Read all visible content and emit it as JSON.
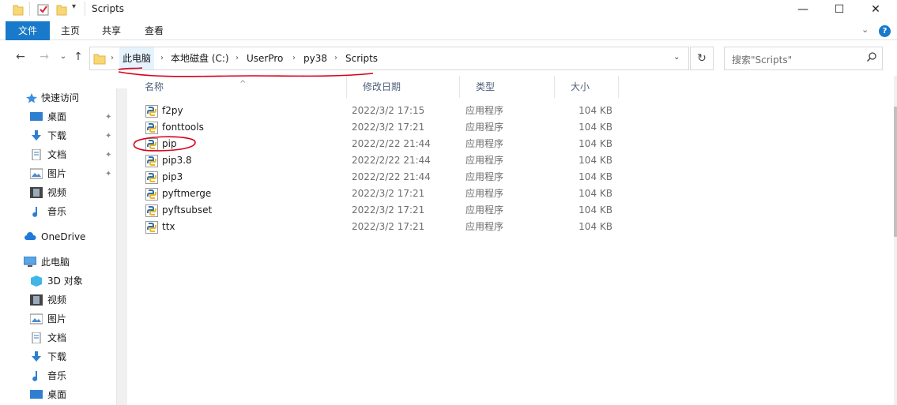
{
  "window": {
    "title": "Scripts",
    "minimize_label": "—",
    "maximize_label": "☐",
    "close_label": "✕"
  },
  "ribbon": {
    "tabs": [
      {
        "label": "文件",
        "active": true
      },
      {
        "label": "主页"
      },
      {
        "label": "共享"
      },
      {
        "label": "查看"
      }
    ],
    "collapse_label": "⌄",
    "help_label": "?"
  },
  "nav": {
    "back_label": "←",
    "forward_label": "→",
    "recent_label": "⌄",
    "up_label": "↑",
    "breadcrumbs": [
      "此电脑",
      "本地磁盘 (C:)",
      "UserPro",
      "py38",
      "Scripts"
    ],
    "refresh_label": "↻"
  },
  "search": {
    "placeholder": "搜索\"Scripts\""
  },
  "sidebar": {
    "items": [
      {
        "label": "快速访问",
        "icon": "star-icon"
      },
      {
        "label": "桌面",
        "icon": "desktop-icon",
        "pinned": true
      },
      {
        "label": "下载",
        "icon": "download-icon",
        "pinned": true
      },
      {
        "label": "文档",
        "icon": "document-icon",
        "pinned": true
      },
      {
        "label": "图片",
        "icon": "picture-icon",
        "pinned": true
      },
      {
        "label": "视频",
        "icon": "video-icon"
      },
      {
        "label": "音乐",
        "icon": "music-icon"
      },
      {
        "label": "OneDrive",
        "icon": "cloud-icon"
      },
      {
        "label": "此电脑",
        "icon": "computer-icon"
      },
      {
        "label": "3D 对象",
        "icon": "cube-icon"
      },
      {
        "label": "视频",
        "icon": "video-icon"
      },
      {
        "label": "图片",
        "icon": "picture-icon"
      },
      {
        "label": "文档",
        "icon": "document-icon"
      },
      {
        "label": "下载",
        "icon": "download-icon"
      },
      {
        "label": "音乐",
        "icon": "music-icon"
      },
      {
        "label": "桌面",
        "icon": "desktop-icon"
      }
    ],
    "pin_glyph": "📌"
  },
  "filelist": {
    "columns": {
      "name": "名称",
      "date": "修改日期",
      "type": "类型",
      "size": "大小"
    },
    "sort_glyph": "^",
    "rows": [
      {
        "name": "f2py",
        "date": "2022/3/2 17:15",
        "type": "应用程序",
        "size": "104 KB"
      },
      {
        "name": "fonttools",
        "date": "2022/3/2 17:21",
        "type": "应用程序",
        "size": "104 KB"
      },
      {
        "name": "pip",
        "date": "2022/2/22 21:44",
        "type": "应用程序",
        "size": "104 KB"
      },
      {
        "name": "pip3.8",
        "date": "2022/2/22 21:44",
        "type": "应用程序",
        "size": "104 KB"
      },
      {
        "name": "pip3",
        "date": "2022/2/22 21:44",
        "type": "应用程序",
        "size": "104 KB"
      },
      {
        "name": "pyftmerge",
        "date": "2022/3/2 17:21",
        "type": "应用程序",
        "size": "104 KB"
      },
      {
        "name": "pyftsubset",
        "date": "2022/3/2 17:21",
        "type": "应用程序",
        "size": "104 KB"
      },
      {
        "name": "ttx",
        "date": "2022/3/2 17:21",
        "type": "应用程序",
        "size": "104 KB"
      }
    ]
  },
  "colors": {
    "accent": "#1979ca",
    "annotation": "#d9001b"
  }
}
